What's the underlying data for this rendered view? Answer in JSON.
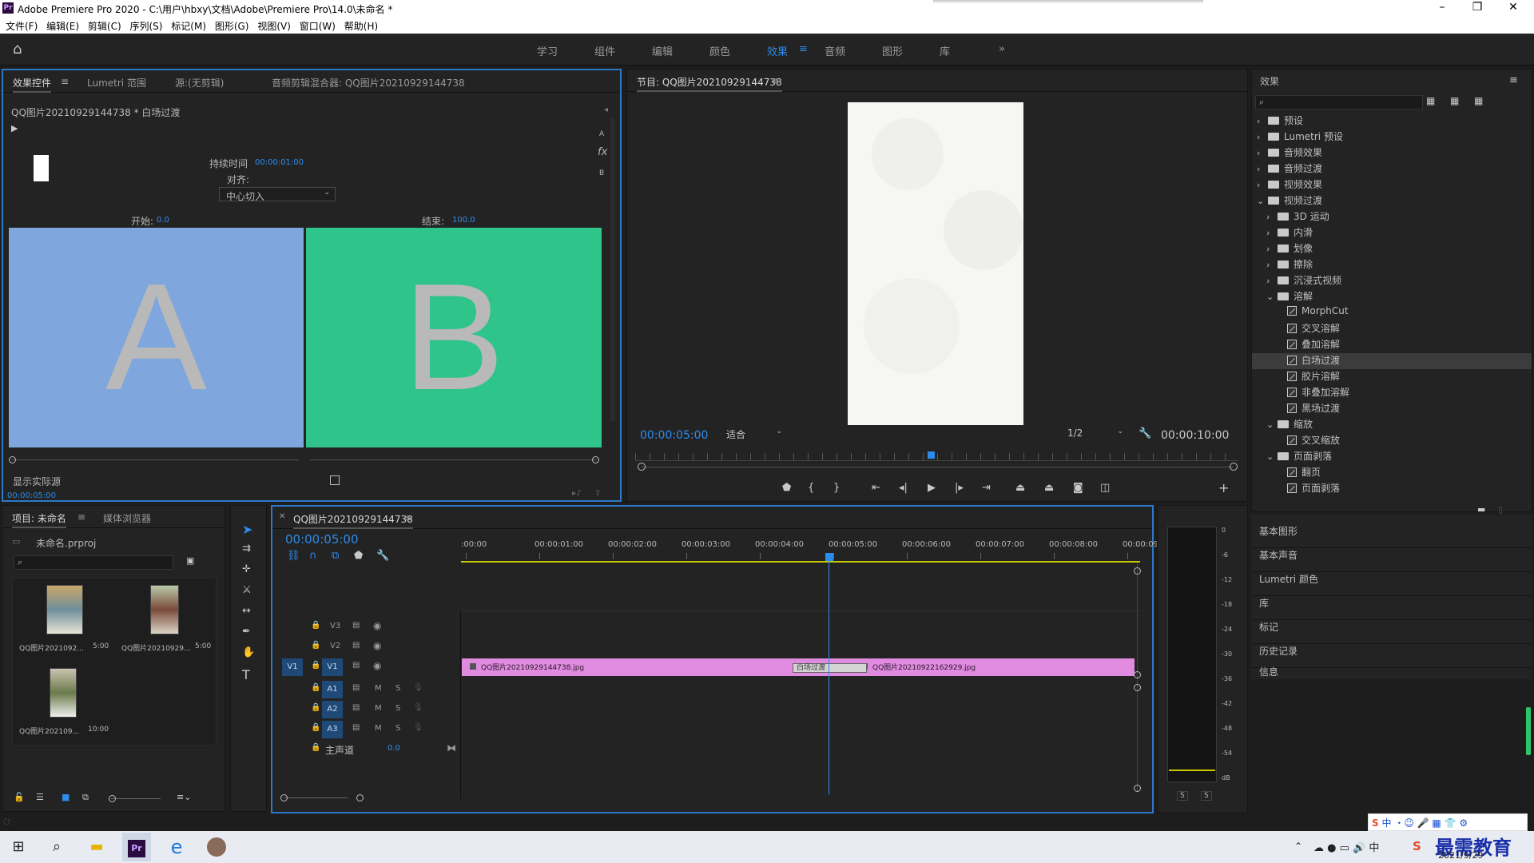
{
  "window": {
    "title": "Adobe Premiere Pro 2020 - C:\\用户\\hbxy\\文档\\Adobe\\Premiere Pro\\14.0\\未命名 *",
    "logo": "Pr"
  },
  "menu": [
    "文件(F)",
    "编辑(E)",
    "剪辑(C)",
    "序列(S)",
    "标记(M)",
    "图形(G)",
    "视图(V)",
    "窗口(W)",
    "帮助(H)"
  ],
  "workspaces": [
    "学习",
    "组件",
    "编辑",
    "颜色",
    "效果",
    "音频",
    "图形",
    "库"
  ],
  "active_workspace": "效果",
  "effect_controls": {
    "tabs": [
      "效果控件",
      "Lumetri 范围",
      "源:(无剪辑)",
      "音频剪辑混合器: QQ图片20210929144738"
    ],
    "clip_path": "QQ图片20210929144738 * 白场过渡",
    "duration_label": "持续时间",
    "duration_value": "00:00:01:00",
    "align_label": "对齐:",
    "align_value": "中心切入",
    "start_label": "开始:",
    "start_value": "0.0",
    "end_label": "结束:",
    "end_value": "100.0",
    "side_a": "A",
    "side_b": "B",
    "side_a_color": "#7fa6dd",
    "side_b_color": "#2ec48a",
    "show_actual": "显示实际源",
    "timecode": "00:00:05:00",
    "mini_a": "A",
    "mini_b": "B",
    "fx": "fx"
  },
  "program": {
    "title": "节目: QQ图片20210929144738",
    "timecode": "00:00:05:00",
    "fit": "适合",
    "quality": "1/2",
    "duration": "00:00:10:00"
  },
  "effects_panel": {
    "title": "效果",
    "items": [
      {
        "label": "预设",
        "type": "folder",
        "level": 0,
        "exp": "›"
      },
      {
        "label": "Lumetri 预设",
        "type": "folder",
        "level": 0,
        "exp": "›"
      },
      {
        "label": "音频效果",
        "type": "folder",
        "level": 0,
        "exp": "›"
      },
      {
        "label": "音频过渡",
        "type": "folder",
        "level": 0,
        "exp": "›"
      },
      {
        "label": "视频效果",
        "type": "folder",
        "level": 0,
        "exp": "›"
      },
      {
        "label": "视频过渡",
        "type": "folder",
        "level": 0,
        "exp": "⌄"
      },
      {
        "label": "3D 运动",
        "type": "folder",
        "level": 1,
        "exp": "›"
      },
      {
        "label": "内滑",
        "type": "folder",
        "level": 1,
        "exp": "›"
      },
      {
        "label": "划像",
        "type": "folder",
        "level": 1,
        "exp": "›"
      },
      {
        "label": "擦除",
        "type": "folder",
        "level": 1,
        "exp": "›"
      },
      {
        "label": "沉浸式视频",
        "type": "folder",
        "level": 1,
        "exp": "›"
      },
      {
        "label": "溶解",
        "type": "folder",
        "level": 1,
        "exp": "⌄"
      },
      {
        "label": "MorphCut",
        "type": "fx",
        "level": 2,
        "exp": ""
      },
      {
        "label": "交叉溶解",
        "type": "fx",
        "level": 2,
        "exp": ""
      },
      {
        "label": "叠加溶解",
        "type": "fx",
        "level": 2,
        "exp": ""
      },
      {
        "label": "白场过渡",
        "type": "fx",
        "level": 2,
        "exp": "",
        "selected": true
      },
      {
        "label": "胶片溶解",
        "type": "fx",
        "level": 2,
        "exp": ""
      },
      {
        "label": "非叠加溶解",
        "type": "fx",
        "level": 2,
        "exp": ""
      },
      {
        "label": "黑场过渡",
        "type": "fx",
        "level": 2,
        "exp": ""
      },
      {
        "label": "缩放",
        "type": "folder",
        "level": 1,
        "exp": "⌄"
      },
      {
        "label": "交叉缩放",
        "type": "fx",
        "level": 2,
        "exp": ""
      },
      {
        "label": "页面剥落",
        "type": "folder",
        "level": 1,
        "exp": "⌄"
      },
      {
        "label": "翻页",
        "type": "fx",
        "level": 2,
        "exp": ""
      },
      {
        "label": "页面剥落",
        "type": "fx",
        "level": 2,
        "exp": ""
      }
    ],
    "sections": [
      "基本图形",
      "基本声音",
      "Lumetri 颜色",
      "库",
      "标记",
      "历史记录",
      "信息"
    ]
  },
  "project": {
    "tabs": [
      "项目: 未命名",
      "媒体浏览器"
    ],
    "file": "未命名.prproj",
    "items": [
      {
        "name": "QQ图片2021092...",
        "dur": "5:00"
      },
      {
        "name": "QQ图片20210929...",
        "dur": "5:00"
      },
      {
        "name": "QQ图片202109...",
        "dur": "10:00"
      }
    ]
  },
  "timeline": {
    "title": "QQ图片20210929144738",
    "timecode": "00:00:05:00",
    "ruler": [
      ":00:00",
      "00:00:01:00",
      "00:00:02:00",
      "00:00:03:00",
      "00:00:04:00",
      "00:00:05:00",
      "00:00:06:00",
      "00:00:07:00",
      "00:00:08:00",
      "00:00:09:"
    ],
    "video_tracks": [
      "V3",
      "V2",
      "V1"
    ],
    "source_patch": "V1",
    "audio_tracks": [
      "A1",
      "A2",
      "A3"
    ],
    "master": "主声道",
    "master_value": "0.0",
    "clip1": "QQ图片20210929144738.jpg",
    "clip2": "QQ图片20210922162929.jpg",
    "transition": "白场过渡",
    "clip_color": "#e08ae0",
    "m": "M",
    "s": "S"
  },
  "meter": {
    "scale": [
      "0",
      "-6",
      "-12",
      "-18",
      "-24",
      "-30",
      "-36",
      "-42",
      "-48",
      "-54",
      "dB"
    ],
    "solo": [
      "S",
      "S"
    ]
  },
  "taskbar": {
    "date": "2021/9/29",
    "watermark": "最需教育",
    "ime": "中"
  }
}
